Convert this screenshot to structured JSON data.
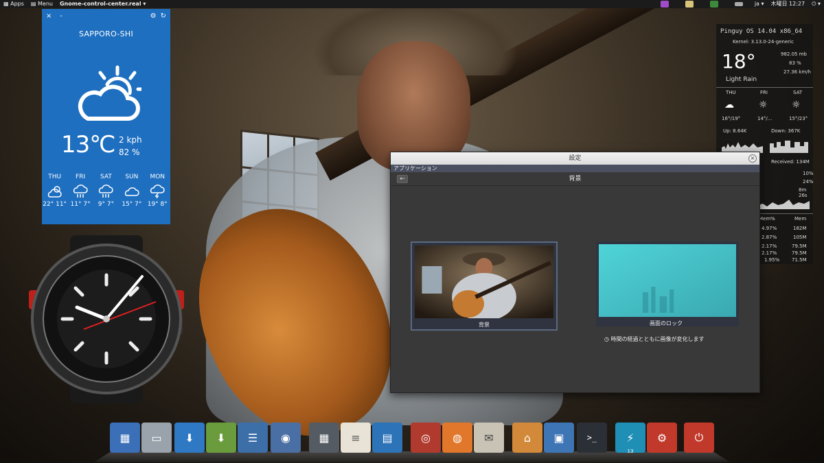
{
  "top_panel": {
    "apps_label": "Apps",
    "menu_label": "Menu",
    "window_title": "Gnome-control-center.real ▾",
    "lang": "ja ▾",
    "clock": "木曜日 12:27",
    "power_glyph": "⏻ ▾"
  },
  "weather": {
    "close_glyph": "×",
    "min_glyph": "-",
    "city": "SAPPORO-SHI",
    "temp": "13℃",
    "wind": "2 kph",
    "humidity": "82 %",
    "forecast": [
      {
        "day": "THU",
        "temps": "22° 11°",
        "icon": "partly-sunny-icon"
      },
      {
        "day": "FRI",
        "temps": "11° 7°",
        "icon": "rain-icon"
      },
      {
        "day": "SAT",
        "temps": "9° 7°",
        "icon": "rain-icon"
      },
      {
        "day": "SUN",
        "temps": "15° 7°",
        "icon": "cloud-icon"
      },
      {
        "day": "MON",
        "temps": "19° 8°",
        "icon": "storm-icon"
      }
    ]
  },
  "sysmon": {
    "os": "Pinguy OS 14.04 x86_64",
    "kernel": "Kernel: 3.13.0-24-generic",
    "temp": "18°",
    "pressure": "982.05 mb",
    "humidity": "83 %",
    "wind": "27.36 km/h",
    "condition": "Light Rain",
    "days": [
      {
        "day": "THU",
        "temps": "16°/19°"
      },
      {
        "day": "FRI",
        "temps": "14°/..."
      },
      {
        "day": "SAT",
        "temps": "15°/23°"
      }
    ],
    "up": "Up: 8.64K",
    "down": "Down: 367K",
    "received": "Received: 134M",
    "cpu1": "10%",
    "cpu2": "24%",
    "uptime": "8m 26s",
    "col_mem_pct": "Mem%",
    "col_mem": "Mem",
    "procs": [
      {
        "pct": "4.97%",
        "mem": "182M"
      },
      {
        "pct": "2.87%",
        "mem": "105M"
      },
      {
        "pct": "2.17%",
        "mem": "79.5M"
      },
      {
        "pct": "2.17%",
        "mem": "79.5M"
      },
      {
        "pct": "1.95%",
        "mem": "71.5M"
      }
    ]
  },
  "settings": {
    "title": "設定",
    "close_glyph": "×",
    "menubar": "アプリケーション",
    "back_glyph": "←",
    "heading": "背景",
    "thumb1_label": "背景",
    "thumb2_label": "画面のロック",
    "note": "◷ 時間の経過とともに画像が変化します"
  },
  "dock": {
    "items": [
      {
        "name": "app-grid-icon",
        "color": "#3b6fb8",
        "glyph": "▦"
      },
      {
        "name": "file-manager-icon",
        "color": "#9aa3ab",
        "glyph": "▭"
      },
      {
        "name": "software-center-icon",
        "color": "#2f78c4",
        "glyph": "⬇"
      },
      {
        "name": "update-manager-icon",
        "color": "#6a9c3d",
        "glyph": "⬇"
      },
      {
        "name": "system-settings-icon",
        "color": "#3c6ea8",
        "glyph": "☰"
      },
      {
        "name": "webcam-icon",
        "color": "#4a6fa5",
        "glyph": "◉"
      },
      {
        "name": "calculator-icon",
        "color": "#555b62",
        "glyph": "▦"
      },
      {
        "name": "notes-icon",
        "color": "#e8e3d6",
        "glyph": "≡"
      },
      {
        "name": "document-writer-icon",
        "color": "#2d73b8",
        "glyph": "▤"
      },
      {
        "name": "chrome-icon",
        "color": "#b03a2e",
        "glyph": "◎"
      },
      {
        "name": "firefox-icon",
        "color": "#e0772b",
        "glyph": "◍"
      },
      {
        "name": "mail-icon",
        "color": "#c9c3b6",
        "glyph": "✉"
      },
      {
        "name": "home-folder-icon",
        "color": "#d28a3a",
        "glyph": "⌂"
      },
      {
        "name": "workspace-icon",
        "color": "#3e75b5",
        "glyph": "▣"
      },
      {
        "name": "terminal-icon",
        "color": "#2b2f36",
        "glyph": ">_"
      },
      {
        "name": "weather-app-icon",
        "color": "#1f8fb6",
        "glyph": "⚡"
      },
      {
        "name": "settings-gear-icon",
        "color": "#c0392b",
        "glyph": "⚙"
      },
      {
        "name": "power-icon",
        "color": "#c0392b",
        "glyph": "⏻"
      }
    ],
    "weather_badge": "13"
  }
}
